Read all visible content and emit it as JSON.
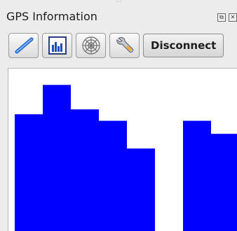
{
  "window": {
    "title": "GPS Information",
    "grip_glyph": "⋯",
    "float_glyph": "⧉",
    "close_glyph": "✕"
  },
  "toolbar": {
    "buttons": [
      {
        "name": "pen-icon"
      },
      {
        "name": "bar-chart-icon"
      },
      {
        "name": "polar-chart-icon"
      },
      {
        "name": "wrench-icon"
      }
    ],
    "disconnect_label": "Disconnect"
  },
  "colors": {
    "bar_fill": "#0000ff",
    "panel_bg": "#ffffff",
    "window_bg": "#ececec"
  },
  "chart_data": {
    "type": "bar",
    "title": "",
    "xlabel": "",
    "ylabel": "",
    "grid": false,
    "series": [
      {
        "values": [
          72,
          90,
          75,
          68,
          51,
          0,
          68,
          60
        ]
      }
    ],
    "ylim": [
      0,
      100
    ],
    "note_values": "relative signal strength per satellite channel as shown by bar height"
  }
}
